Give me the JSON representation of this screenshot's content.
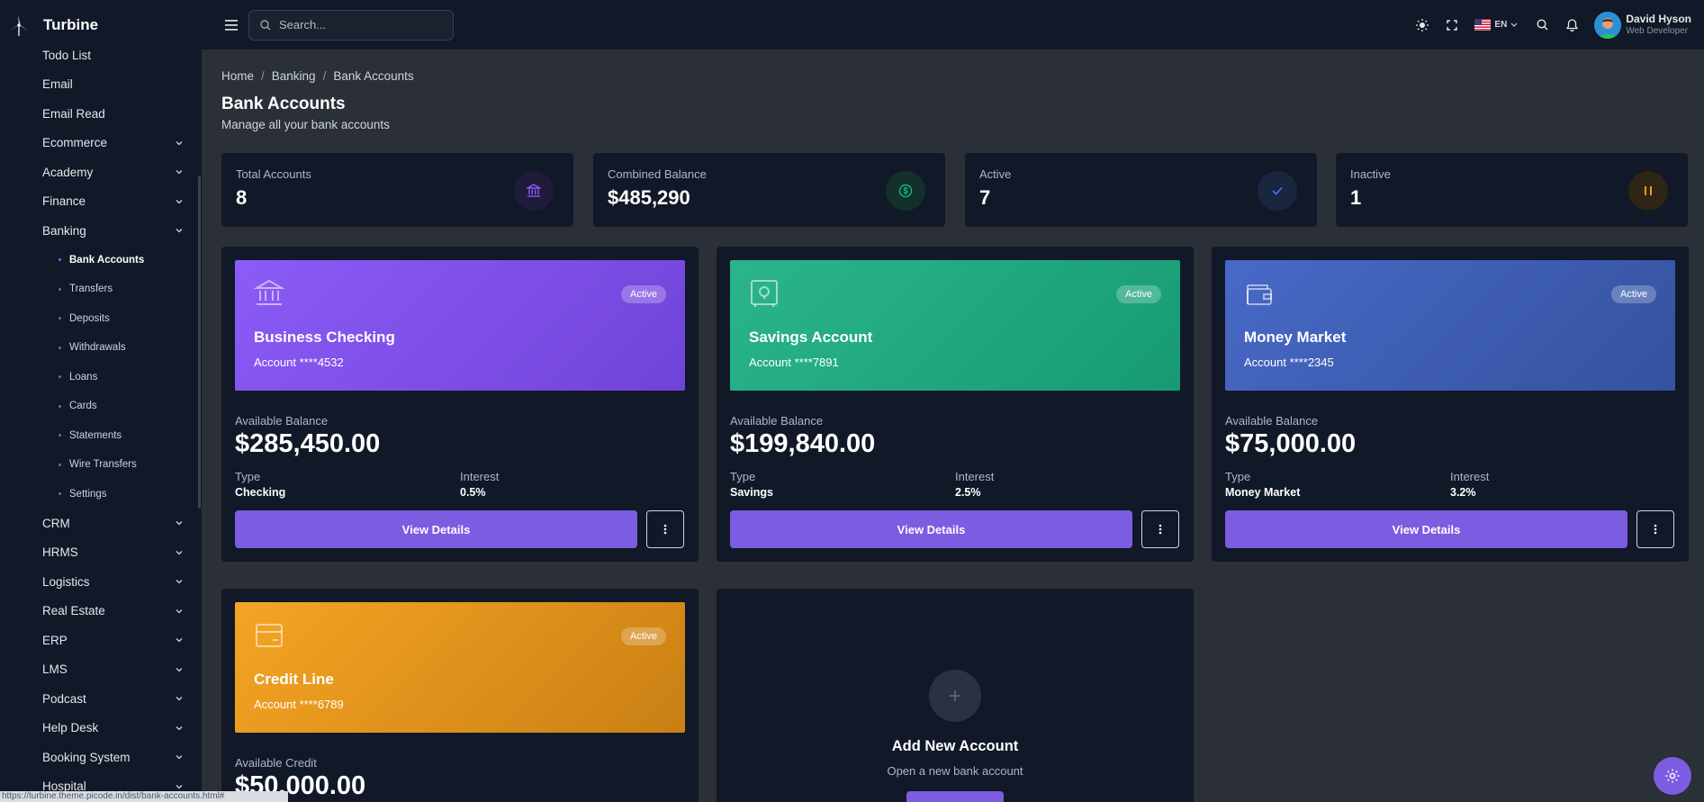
{
  "app": {
    "name": "Turbine"
  },
  "header": {
    "search_placeholder": "Search...",
    "language": "EN",
    "user": {
      "name": "David Hyson",
      "role": "Web Developer"
    }
  },
  "sidebar": {
    "items": [
      {
        "label": "Todo List"
      },
      {
        "label": "Email"
      },
      {
        "label": "Email Read"
      },
      {
        "label": "Ecommerce"
      },
      {
        "label": "Academy"
      },
      {
        "label": "Finance"
      },
      {
        "label": "Banking"
      }
    ],
    "banking_sub": [
      {
        "label": "Bank Accounts"
      },
      {
        "label": "Transfers"
      },
      {
        "label": "Deposits"
      },
      {
        "label": "Withdrawals"
      },
      {
        "label": "Loans"
      },
      {
        "label": "Cards"
      },
      {
        "label": "Statements"
      },
      {
        "label": "Wire Transfers"
      },
      {
        "label": "Settings"
      }
    ],
    "items_after": [
      {
        "label": "CRM"
      },
      {
        "label": "HRMS"
      },
      {
        "label": "Logistics"
      },
      {
        "label": "Real Estate"
      },
      {
        "label": "ERP"
      },
      {
        "label": "LMS"
      },
      {
        "label": "Podcast"
      },
      {
        "label": "Help Desk"
      },
      {
        "label": "Booking System"
      },
      {
        "label": "Hospital"
      }
    ]
  },
  "breadcrumb": [
    "Home",
    "Banking",
    "Bank Accounts"
  ],
  "page": {
    "title": "Bank Accounts",
    "subtitle": "Manage all your bank accounts"
  },
  "stats": [
    {
      "label": "Total Accounts",
      "value": "8"
    },
    {
      "label": "Combined Balance",
      "value": "$485,290"
    },
    {
      "label": "Active",
      "value": "7"
    },
    {
      "label": "Inactive",
      "value": "1"
    }
  ],
  "accounts": [
    {
      "title": "Business Checking",
      "account": "Account ****4532",
      "badge": "Active",
      "balance_label": "Available Balance",
      "balance": "$285,450.00",
      "type_label": "Type",
      "type": "Checking",
      "interest_label": "Interest",
      "interest": "0.5%",
      "button": "View Details"
    },
    {
      "title": "Savings Account",
      "account": "Account ****7891",
      "badge": "Active",
      "balance_label": "Available Balance",
      "balance": "$199,840.00",
      "type_label": "Type",
      "type": "Savings",
      "interest_label": "Interest",
      "interest": "2.5%",
      "button": "View Details"
    },
    {
      "title": "Money Market",
      "account": "Account ****2345",
      "badge": "Active",
      "balance_label": "Available Balance",
      "balance": "$75,000.00",
      "type_label": "Type",
      "type": "Money Market",
      "interest_label": "Interest",
      "interest": "3.2%",
      "button": "View Details"
    },
    {
      "title": "Credit Line",
      "account": "Account ****6789",
      "badge": "Active",
      "balance_label": "Available Credit",
      "balance": "$50,000.00"
    }
  ],
  "add_account": {
    "title": "Add New Account",
    "subtitle": "Open a new bank account"
  },
  "status_url": "https://turbine.theme.picode.in/dist/bank-accounts.html#",
  "colors": {
    "accent": "#7c5ce0",
    "checking": "#8b5cf6",
    "savings": "#10b981",
    "money_market": "#3b5fb8",
    "credit": "#f59e0b"
  }
}
